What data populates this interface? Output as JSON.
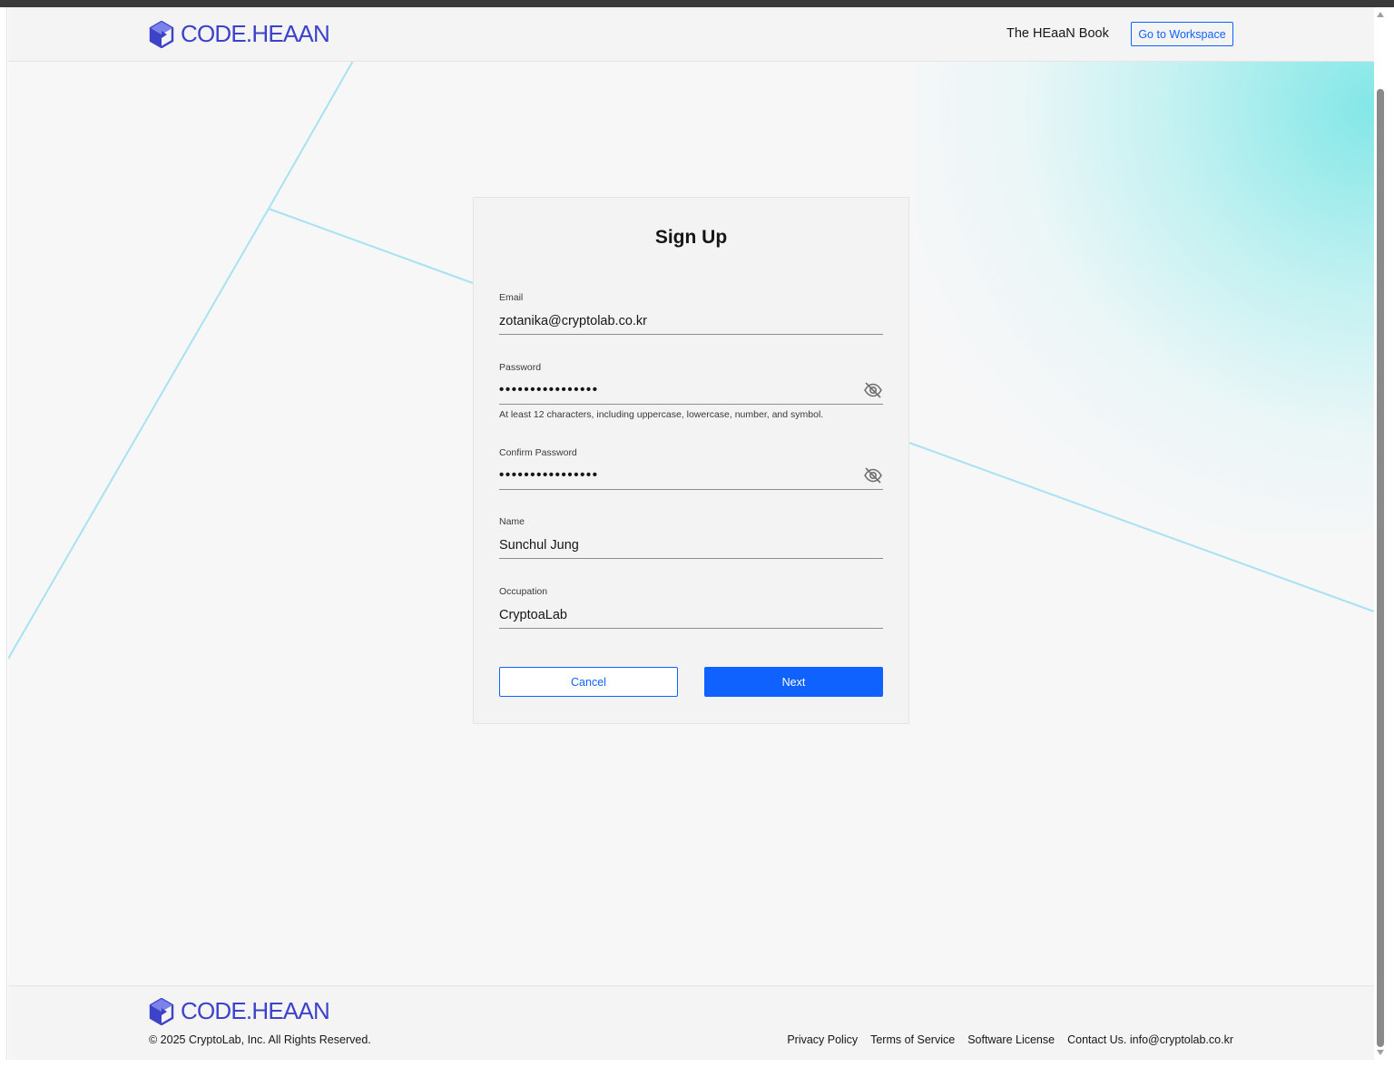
{
  "header": {
    "logo_text": "CODE.HEAAN",
    "nav_book": "The HEaaN Book",
    "workspace_button": "Go to Workspace"
  },
  "form": {
    "title": "Sign Up",
    "fields": [
      {
        "label": "Email",
        "value": "zotanika@cryptolab.co.kr"
      },
      {
        "label": "Password",
        "value": "••••••••••••••••",
        "helper": "At least 12 characters, including uppercase, lowercase, number, and symbol."
      },
      {
        "label": "Confirm Password",
        "value": "••••••••••••••••"
      },
      {
        "label": "Name",
        "value": "Sunchul Jung"
      },
      {
        "label": "Occupation",
        "value": "CryptoaLab"
      }
    ],
    "cancel_button": "Cancel",
    "next_button": "Next"
  },
  "footer": {
    "logo_text": "CODE.HEAAN",
    "copyright": "© 2025 CryptoLab, Inc. All Rights Reserved.",
    "links": [
      "Privacy Policy",
      "Terms of Service",
      "Software License",
      "Contact Us. info@cryptolab.co.kr"
    ]
  },
  "icons": {
    "logo": "hexagon-logo-icon",
    "password_toggle": "eye-slash-icon"
  },
  "colors": {
    "brand_logo": "#3d43c9",
    "primary_button": "#0f62fe",
    "decorative_lines": "#a8e2f2",
    "gradient_accent": "#6ee4e4"
  }
}
